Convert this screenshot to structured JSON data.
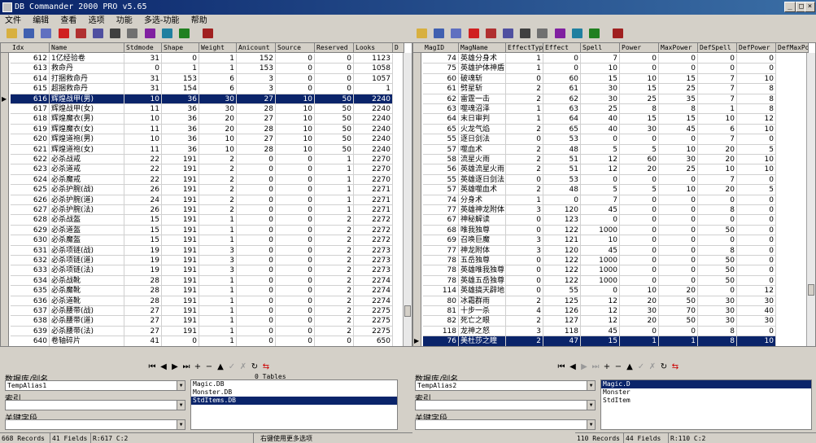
{
  "title": "DB Commander 2000 PRO v5.65",
  "menu": [
    "文件",
    "编辑",
    "查看",
    "选项",
    "功能",
    "多选-功能",
    "帮助"
  ],
  "left": {
    "columns": [
      "Idx",
      "Name",
      "Stdmode",
      "Shape",
      "Weight",
      "Anicount",
      "Source",
      "Reserved",
      "Looks",
      "D"
    ],
    "rows": [
      [
        "612",
        "1亿经验卷",
        "31",
        "0",
        "1",
        "152",
        "0",
        "0",
        "1123"
      ],
      [
        "613",
        "救命丹",
        "0",
        "1",
        "1",
        "153",
        "0",
        "0",
        "1058"
      ],
      [
        "614",
        "打捆救命丹",
        "31",
        "153",
        "6",
        "3",
        "0",
        "0",
        "1057"
      ],
      [
        "615",
        "超捆救命丹",
        "31",
        "154",
        "6",
        "3",
        "0",
        "0",
        "1"
      ],
      [
        "616",
        "辉煌战甲(男)",
        "10",
        "36",
        "30",
        "27",
        "10",
        "50",
        "2240"
      ],
      [
        "617",
        "辉煌战甲(女)",
        "11",
        "36",
        "30",
        "28",
        "10",
        "50",
        "2240"
      ],
      [
        "618",
        "辉煌魔衣(男)",
        "10",
        "36",
        "20",
        "27",
        "10",
        "50",
        "2240"
      ],
      [
        "619",
        "辉煌魔衣(女)",
        "11",
        "36",
        "20",
        "28",
        "10",
        "50",
        "2240"
      ],
      [
        "620",
        "辉煌道袍(男)",
        "10",
        "36",
        "10",
        "27",
        "10",
        "50",
        "2240"
      ],
      [
        "621",
        "辉煌道袍(女)",
        "11",
        "36",
        "10",
        "28",
        "10",
        "50",
        "2240"
      ],
      [
        "622",
        "必杀战戒",
        "22",
        "191",
        "2",
        "0",
        "0",
        "1",
        "2270"
      ],
      [
        "623",
        "必杀道戒",
        "22",
        "191",
        "2",
        "0",
        "0",
        "1",
        "2270"
      ],
      [
        "624",
        "必杀魔戒",
        "22",
        "191",
        "2",
        "0",
        "0",
        "1",
        "2270"
      ],
      [
        "625",
        "必杀护腕(战)",
        "26",
        "191",
        "2",
        "0",
        "0",
        "1",
        "2271"
      ],
      [
        "626",
        "必杀护腕(道)",
        "24",
        "191",
        "2",
        "0",
        "0",
        "1",
        "2271"
      ],
      [
        "627",
        "必杀护腕(法)",
        "26",
        "191",
        "2",
        "0",
        "0",
        "1",
        "2271"
      ],
      [
        "628",
        "必杀战盔",
        "15",
        "191",
        "1",
        "0",
        "0",
        "2",
        "2272"
      ],
      [
        "629",
        "必杀道盔",
        "15",
        "191",
        "1",
        "0",
        "0",
        "2",
        "2272"
      ],
      [
        "630",
        "必杀魔盔",
        "15",
        "191",
        "1",
        "0",
        "0",
        "2",
        "2272"
      ],
      [
        "631",
        "必杀项链(战)",
        "19",
        "191",
        "3",
        "0",
        "0",
        "2",
        "2273"
      ],
      [
        "632",
        "必杀项链(道)",
        "19",
        "191",
        "3",
        "0",
        "0",
        "2",
        "2273"
      ],
      [
        "633",
        "必杀项链(法)",
        "19",
        "191",
        "3",
        "0",
        "0",
        "2",
        "2273"
      ],
      [
        "634",
        "必杀战靴",
        "28",
        "191",
        "1",
        "0",
        "0",
        "2",
        "2274"
      ],
      [
        "635",
        "必杀魔靴",
        "28",
        "191",
        "1",
        "0",
        "0",
        "2",
        "2274"
      ],
      [
        "636",
        "必杀道靴",
        "28",
        "191",
        "1",
        "0",
        "0",
        "2",
        "2274"
      ],
      [
        "637",
        "必杀腰带(战)",
        "27",
        "191",
        "1",
        "0",
        "0",
        "2",
        "2275"
      ],
      [
        "638",
        "必杀腰带(道)",
        "27",
        "191",
        "1",
        "0",
        "0",
        "2",
        "2275"
      ],
      [
        "639",
        "必杀腰带(法)",
        "27",
        "191",
        "1",
        "0",
        "0",
        "2",
        "2275"
      ],
      [
        "640",
        "卷轴碎片",
        "41",
        "0",
        "1",
        "0",
        "0",
        "0",
        "650"
      ]
    ],
    "selected_row": 4,
    "tables_count_label": "0 Tables",
    "alias_label": "数据库/别名",
    "alias_value": "TempAlias1",
    "index_label": "索引",
    "key_label": "关键字段",
    "tables": [
      "Magic.DB",
      "Monster.DB",
      "StdItems.DB"
    ],
    "selected_table": 2,
    "status": [
      "668 Records",
      "41 Fields",
      "R:617 C:2",
      "右键使用更多选项"
    ]
  },
  "right": {
    "columns": [
      "MagID",
      "MagName",
      "EffectType",
      "Effect",
      "Spell",
      "Power",
      "MaxPower",
      "DefSpell",
      "DefPower",
      "DefMaxPo"
    ],
    "rows": [
      [
        "74",
        "英雄分身术",
        "1",
        "0",
        "7",
        "0",
        "0",
        "0",
        "0"
      ],
      [
        "75",
        "英雄护体神盾",
        "1",
        "0",
        "10",
        "0",
        "0",
        "0",
        "0"
      ],
      [
        "60",
        "破魂斩",
        "0",
        "60",
        "15",
        "10",
        "15",
        "7",
        "10"
      ],
      [
        "61",
        "劈星斩",
        "2",
        "61",
        "30",
        "15",
        "25",
        "7",
        "8"
      ],
      [
        "62",
        "雷霆一击",
        "2",
        "62",
        "30",
        "25",
        "35",
        "7",
        "8"
      ],
      [
        "63",
        "噬魂沼泽",
        "1",
        "63",
        "25",
        "8",
        "8",
        "1",
        "8"
      ],
      [
        "64",
        "末日审判",
        "1",
        "64",
        "40",
        "15",
        "15",
        "10",
        "12"
      ],
      [
        "65",
        "火龙气焰",
        "2",
        "65",
        "40",
        "30",
        "45",
        "6",
        "10"
      ],
      [
        "55",
        "逐日剑法",
        "0",
        "53",
        "0",
        "0",
        "0",
        "7",
        "0"
      ],
      [
        "57",
        "噬血术",
        "2",
        "48",
        "5",
        "5",
        "10",
        "20",
        "5"
      ],
      [
        "58",
        "流星火雨",
        "2",
        "51",
        "12",
        "60",
        "30",
        "20",
        "10"
      ],
      [
        "56",
        "英雄流星火雨",
        "2",
        "51",
        "12",
        "20",
        "25",
        "10",
        "10"
      ],
      [
        "55",
        "英雄逐日剑法",
        "0",
        "53",
        "0",
        "0",
        "0",
        "7",
        "0"
      ],
      [
        "57",
        "英雄噬血术",
        "2",
        "48",
        "5",
        "5",
        "10",
        "20",
        "5"
      ],
      [
        "74",
        "分身术",
        "1",
        "0",
        "7",
        "0",
        "0",
        "0",
        "0"
      ],
      [
        "77",
        "英雄神龙附体",
        "3",
        "120",
        "45",
        "0",
        "0",
        "8",
        "0"
      ],
      [
        "67",
        "神秘解读",
        "0",
        "123",
        "0",
        "0",
        "0",
        "0",
        "0"
      ],
      [
        "68",
        "唯我独尊",
        "0",
        "122",
        "1000",
        "0",
        "0",
        "50",
        "0"
      ],
      [
        "69",
        "召唤巨魔",
        "3",
        "121",
        "10",
        "0",
        "0",
        "0",
        "0"
      ],
      [
        "77",
        "神龙附体",
        "3",
        "120",
        "45",
        "0",
        "0",
        "8",
        "0"
      ],
      [
        "78",
        "五岳独尊",
        "0",
        "122",
        "1000",
        "0",
        "0",
        "50",
        "0"
      ],
      [
        "78",
        "英雄唯我独尊",
        "0",
        "122",
        "1000",
        "0",
        "0",
        "50",
        "0"
      ],
      [
        "78",
        "英雄五岳独尊",
        "0",
        "122",
        "1000",
        "0",
        "0",
        "50",
        "0"
      ],
      [
        "114",
        "英雄搞天辟地",
        "0",
        "55",
        "0",
        "10",
        "20",
        "0",
        "12"
      ],
      [
        "80",
        "冰霜群雨",
        "2",
        "125",
        "12",
        "20",
        "50",
        "30",
        "30"
      ],
      [
        "81",
        "十步一杀",
        "4",
        "126",
        "12",
        "30",
        "70",
        "30",
        "40"
      ],
      [
        "82",
        "死亡之眼",
        "2",
        "127",
        "12",
        "20",
        "50",
        "30",
        "30"
      ],
      [
        "118",
        "龙神之怒",
        "3",
        "118",
        "45",
        "0",
        "0",
        "8",
        "0"
      ],
      [
        "76",
        "美杜莎之瞳",
        "2",
        "47",
        "15",
        "1",
        "1",
        "8",
        "10"
      ]
    ],
    "selected_row": 28,
    "alias_label": "数据库/别名",
    "alias_value": "TempAlias2",
    "index_label": "索引",
    "key_label": "关键字段",
    "tables": [
      "Magic.D",
      "Monster",
      "StdItem"
    ],
    "selected_table": 0,
    "status": [
      "110 Records",
      "44 Fields",
      "R:110 C:2"
    ]
  },
  "colors": {
    "selection": "#0a246a",
    "title_start": "#0a246a",
    "title_end": "#3a6ea5"
  }
}
